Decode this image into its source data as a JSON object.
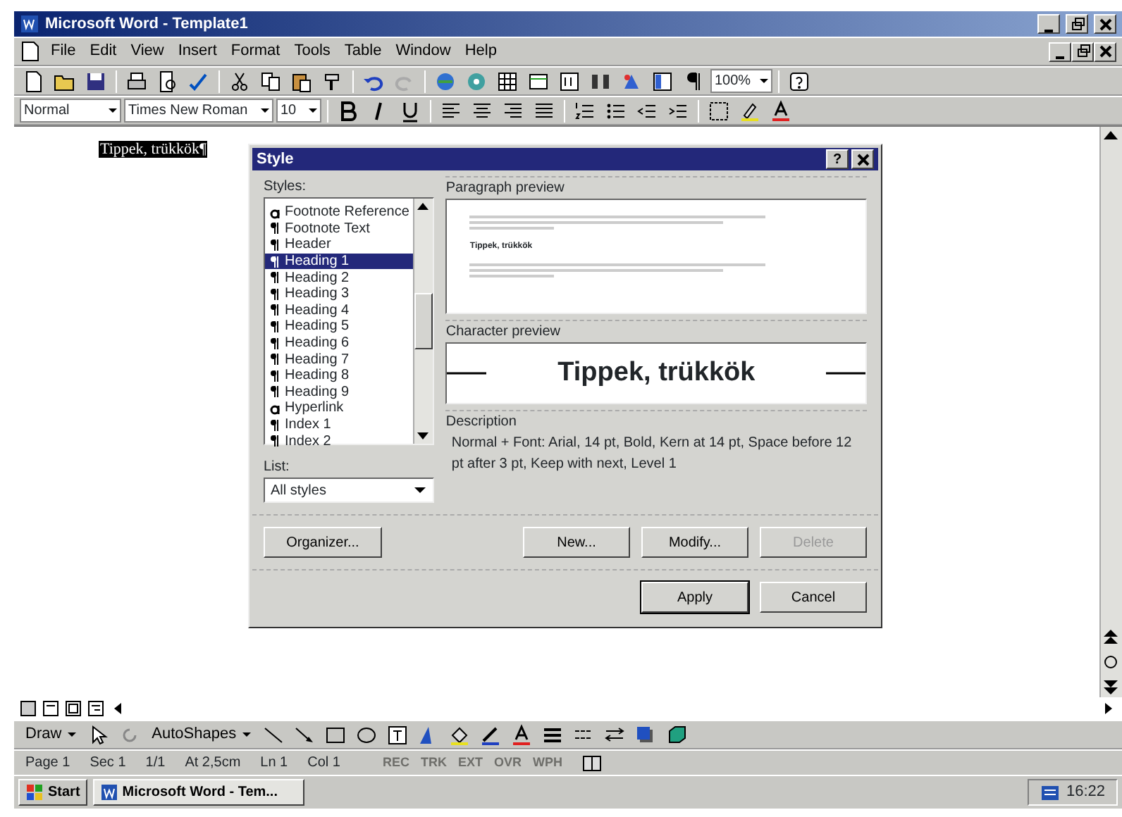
{
  "window": {
    "title": "Microsoft Word - Template1"
  },
  "menu": [
    {
      "label": "File"
    },
    {
      "label": "Edit"
    },
    {
      "label": "View"
    },
    {
      "label": "Insert"
    },
    {
      "label": "Format"
    },
    {
      "label": "Tools"
    },
    {
      "label": "Table"
    },
    {
      "label": "Window"
    },
    {
      "label": "Help"
    }
  ],
  "standard_toolbar": {
    "zoom": "100%"
  },
  "formatting_toolbar": {
    "style": "Normal",
    "font": "Times New Roman",
    "size": "10"
  },
  "document": {
    "text": "Tippek, trükkök¶",
    "selected": true
  },
  "dialog": {
    "title": "Style",
    "help": "?",
    "styles_label": "Styles:",
    "styles": [
      {
        "name": "Footnote Reference",
        "kind": "character",
        "selected": false
      },
      {
        "name": "Footnote Text",
        "kind": "paragraph",
        "selected": false
      },
      {
        "name": "Header",
        "kind": "paragraph",
        "selected": false
      },
      {
        "name": "Heading 1",
        "kind": "paragraph",
        "selected": true
      },
      {
        "name": "Heading 2",
        "kind": "paragraph",
        "selected": false
      },
      {
        "name": "Heading 3",
        "kind": "paragraph",
        "selected": false
      },
      {
        "name": "Heading 4",
        "kind": "paragraph",
        "selected": false
      },
      {
        "name": "Heading 5",
        "kind": "paragraph",
        "selected": false
      },
      {
        "name": "Heading 6",
        "kind": "paragraph",
        "selected": false
      },
      {
        "name": "Heading 7",
        "kind": "paragraph",
        "selected": false
      },
      {
        "name": "Heading 8",
        "kind": "paragraph",
        "selected": false
      },
      {
        "name": "Heading 9",
        "kind": "paragraph",
        "selected": false
      },
      {
        "name": "Hyperlink",
        "kind": "character",
        "selected": false
      },
      {
        "name": "Index 1",
        "kind": "paragraph",
        "selected": false
      },
      {
        "name": "Index 2",
        "kind": "paragraph",
        "selected": false
      }
    ],
    "list_label": "List:",
    "list_value": "All styles",
    "paragraph_preview_label": "Paragraph preview",
    "paragraph_preview_text": "Tippek, trükkök",
    "character_preview_label": "Character preview",
    "character_preview_text": "Tippek, trükkök",
    "description_label": "Description",
    "description": "Normal + Font: Arial, 14 pt, Bold, Kern at 14 pt, Space before 12 pt  after 3 pt, Keep with next, Level 1",
    "buttons": [
      {
        "label": "Organizer...",
        "kind": "left",
        "disabled": false,
        "default": false
      },
      {
        "label": "New...",
        "kind": "middle",
        "disabled": false,
        "default": false
      },
      {
        "label": "Modify...",
        "kind": "middle",
        "disabled": false,
        "default": false
      },
      {
        "label": "Delete",
        "kind": "middle",
        "disabled": true,
        "default": false
      },
      {
        "label": "Apply",
        "kind": "bottom",
        "disabled": false,
        "default": true
      },
      {
        "label": "Cancel",
        "kind": "bottom",
        "disabled": false,
        "default": false
      }
    ]
  },
  "drawing_toolbar": {
    "draw": "Draw",
    "autoshapes": "AutoShapes"
  },
  "status_bar": {
    "fields": [
      "Page 1",
      "Sec 1",
      "1/1",
      "At 2,5cm",
      "Ln 1",
      "Col 1"
    ],
    "indicators": [
      {
        "label": "REC",
        "on": false
      },
      {
        "label": "TRK",
        "on": false
      },
      {
        "label": "EXT",
        "on": false
      },
      {
        "label": "OVR",
        "on": false
      },
      {
        "label": "WPH",
        "on": false
      }
    ]
  },
  "taskbar": {
    "start": "Start",
    "task": "Microsoft Word - Tem...",
    "clock": "16:22"
  }
}
